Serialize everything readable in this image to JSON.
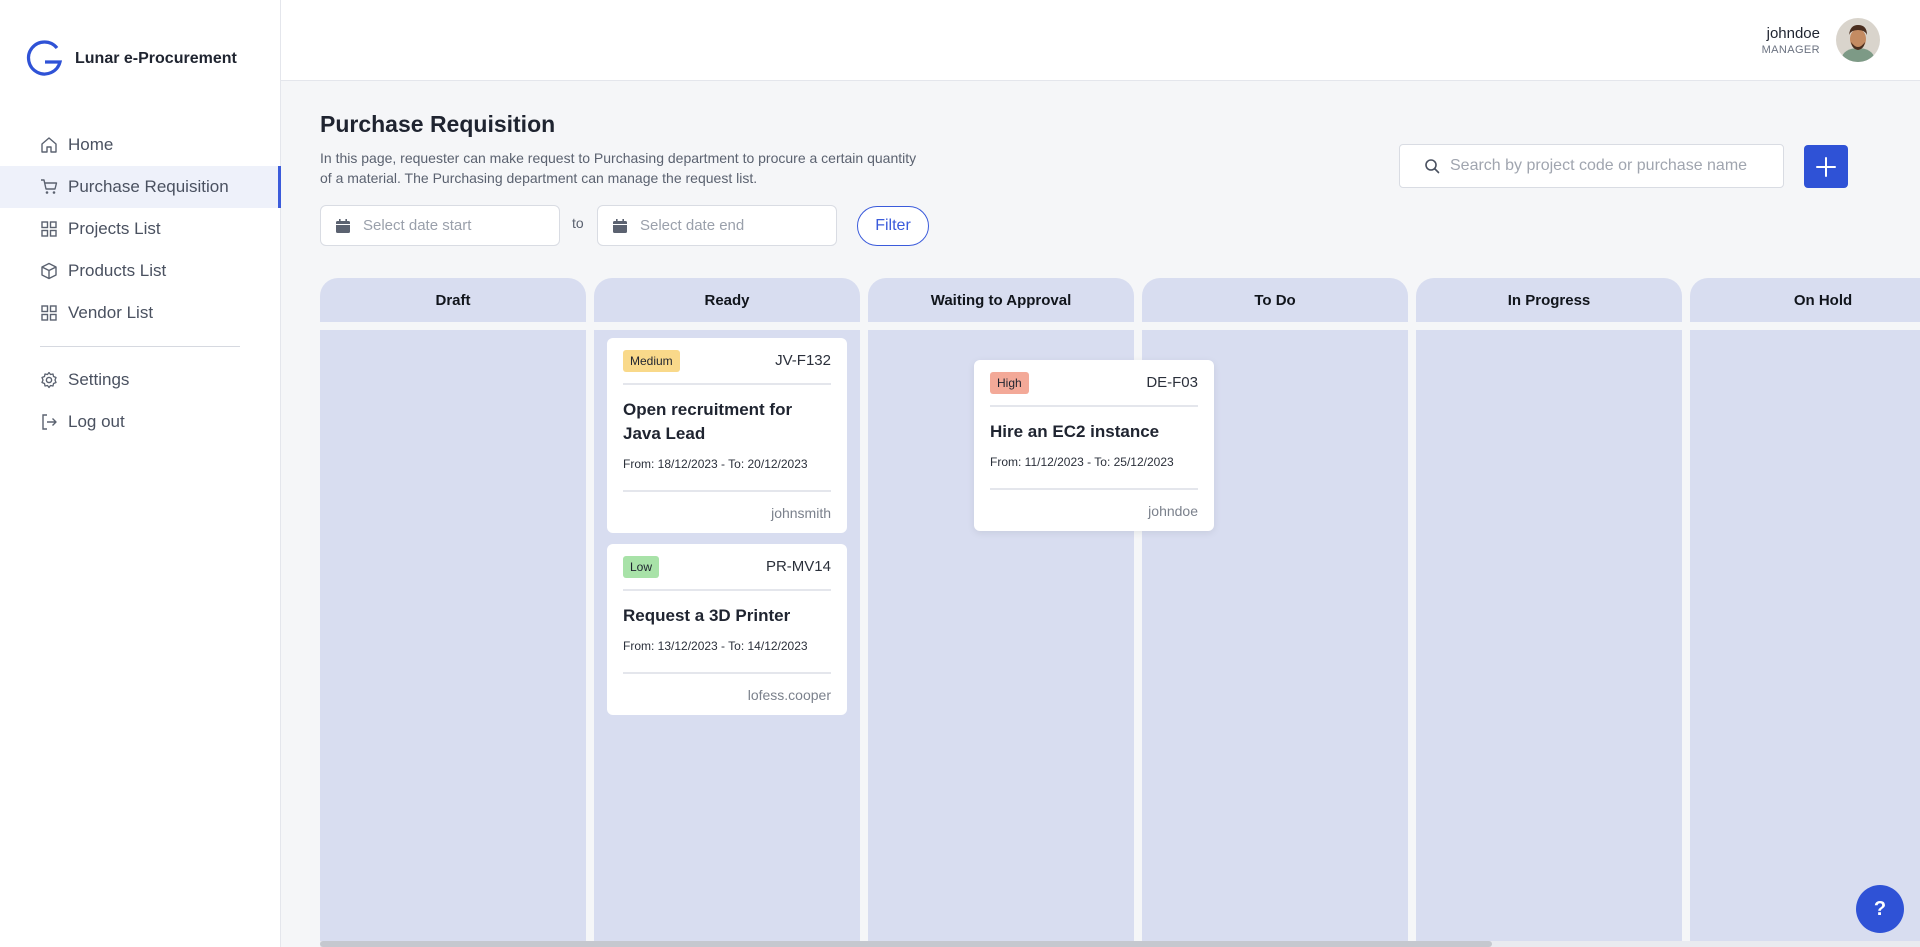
{
  "app": {
    "name": "Lunar e-Procurement"
  },
  "sidebar": {
    "items": [
      {
        "label": "Home",
        "icon": "home-icon"
      },
      {
        "label": "Purchase Requisition",
        "icon": "cart-icon",
        "active": true
      },
      {
        "label": "Projects List",
        "icon": "grid-icon"
      },
      {
        "label": "Products List",
        "icon": "box-icon"
      },
      {
        "label": "Vendor List",
        "icon": "grid-icon"
      }
    ],
    "bottom_items": [
      {
        "label": "Settings",
        "icon": "gear-icon"
      },
      {
        "label": "Log out",
        "icon": "logout-icon"
      }
    ]
  },
  "user": {
    "name": "johndoe",
    "role": "MANAGER"
  },
  "page": {
    "title": "Purchase Requisition",
    "description": "In this page, requester can make request to Purchasing department to procure a certain quantity of a material. The Purchasing department can manage the request list."
  },
  "filters": {
    "date_start_placeholder": "Select date start",
    "to_label": "to",
    "date_end_placeholder": "Select date end",
    "filter_label": "Filter"
  },
  "search": {
    "placeholder": "Search by project code or purchase name"
  },
  "columns": [
    "Draft",
    "Ready",
    "Waiting to Approval",
    "To Do",
    "In Progress",
    "On Hold"
  ],
  "cards": [
    {
      "priority": "Medium",
      "code": "JV-F132",
      "title": "Open recruitment for Java Lead",
      "dates": "From: 18/12/2023 - To: 20/12/2023",
      "user": "johnsmith"
    },
    {
      "priority": "Low",
      "code": "PR-MV14",
      "title": "Request a 3D Printer",
      "dates": "From: 13/12/2023 - To: 14/12/2023",
      "user": "lofess.cooper"
    },
    {
      "priority": "High",
      "code": "DE-F03",
      "title": "Hire an EC2 instance",
      "dates": "From: 11/12/2023 - To: 25/12/2023",
      "user": "johndoe"
    }
  ],
  "help": {
    "label": "?"
  },
  "colors": {
    "accent": "#2f52d6",
    "column_bg": "#d8ddf0",
    "medium": "#f9d98a",
    "low": "#a8e2a8",
    "high": "#f3a998"
  }
}
